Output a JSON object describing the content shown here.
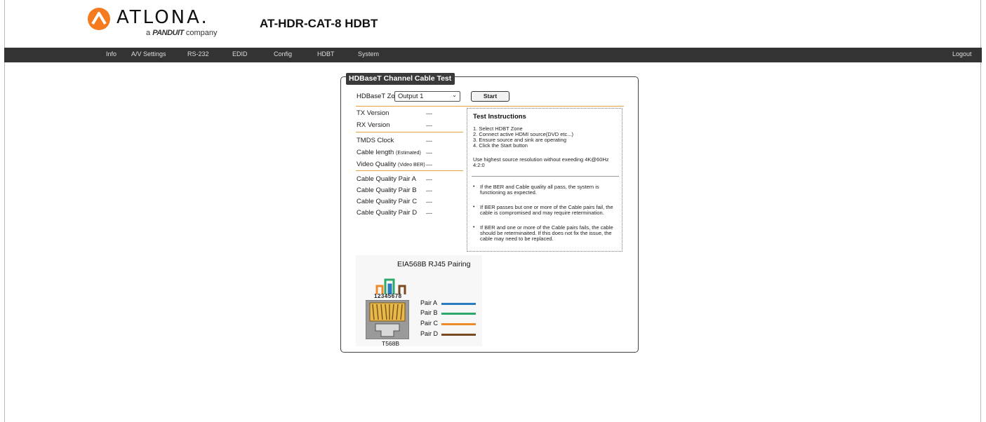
{
  "header": {
    "brand_name": "ATLONA.",
    "brand_sub_prefix": "a",
    "brand_sub_company": "PANDUIT",
    "brand_sub_suffix": "company",
    "product_title": "AT-HDR-CAT-8  HDBT"
  },
  "nav": {
    "items": [
      "Info",
      "A/V Settings",
      "RS-232",
      "EDID",
      "Config",
      "HDBT",
      "System"
    ],
    "logout": "Logout"
  },
  "panel": {
    "legend": "HDBaseT Channel Cable Test",
    "zone_label": "HDBaseT Zone",
    "zone_value": "Output 1",
    "start_label": "Start",
    "fields": [
      {
        "label": "TX Version",
        "note": "",
        "value": "---"
      },
      {
        "label": "RX Version",
        "note": "",
        "value": "---"
      },
      {
        "label": "TMDS Clock",
        "note": "",
        "value": "---"
      },
      {
        "label": "Cable length",
        "note": "(Estimated)",
        "value": "---"
      },
      {
        "label": "Video Quality",
        "note": "(Video BER)",
        "value": "---"
      },
      {
        "label": "Cable Quality Pair A",
        "note": "",
        "value": "---"
      },
      {
        "label": "Cable Quality Pair B",
        "note": "",
        "value": "---"
      },
      {
        "label": "Cable Quality Pair C",
        "note": "",
        "value": "---"
      },
      {
        "label": "Cable Quality Pair D",
        "note": "",
        "value": "---"
      }
    ]
  },
  "instructions": {
    "title": "Test Instructions",
    "steps": [
      "1. Select HDBT Zone",
      "2. Connect active HDMI source(DVD etc...)",
      "3. Ensure source and sink are operating",
      "4. Click the Start button"
    ],
    "note": "Use highest source resolution without exeeding 4K@60Hz 4:2:0",
    "bullets": [
      "If the BER and Cable quality all pass, the system is functioning as expected.",
      "If BER passes but one or more of the Cable pairs fail, the cable is compromised and may require retermination.",
      "If BER and one or more of the Cable pairs fails, the cable should be reterminaited. If this does not fix the issue, the cable may need to be replaced."
    ]
  },
  "diagram": {
    "title": "EIA568B  RJ45 Pairing",
    "pin_numbers": "12345678",
    "standard": "T568B",
    "pairs": [
      {
        "label": "Pair A",
        "color": "#2b7bbf"
      },
      {
        "label": "Pair B",
        "color": "#2ea86a"
      },
      {
        "label": "Pair C",
        "color": "#ee8a2a"
      },
      {
        "label": "Pair D",
        "color": "#7a4a22"
      }
    ]
  },
  "colors": {
    "navbar": "#333333",
    "accent_line": "#e8a040",
    "logo_orange": "#f47b20"
  }
}
